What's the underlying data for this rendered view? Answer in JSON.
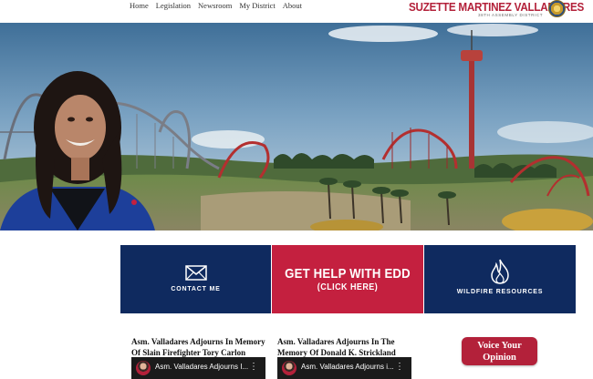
{
  "nav": {
    "items": [
      {
        "label": "Home"
      },
      {
        "label": "Legislation"
      },
      {
        "label": "Newsroom"
      },
      {
        "label": "My District"
      },
      {
        "label": "About"
      }
    ]
  },
  "brand": {
    "name": "SUZETTE MARTINEZ VALLADARES",
    "subtitle": "38TH ASSEMBLY DISTRICT"
  },
  "cta": {
    "contact_label": "CONTACT ME",
    "edd_title": "GET HELP WITH EDD",
    "edd_sub": "(CLICK HERE)",
    "wildfire_label": "WILDFIRE RESOURCES"
  },
  "news": [
    {
      "title_line1": "Asm. Valladares Adjourns In Memory",
      "title_line2": "Of Slain Firefighter Tory Carlon",
      "video_title": "Asm. Valladares Adjourns I..."
    },
    {
      "title_line1": "Asm. Valladares Adjourns In The",
      "title_line2": "Memory Of Donald K. Strickland",
      "video_title": "Asm. Valladares Adjourns i..."
    }
  ],
  "opinion": {
    "line1": "Voice Your",
    "line2": "Opinion"
  },
  "colors": {
    "navy": "#0f2a5f",
    "red": "#c4203f",
    "brand_red": "#b3213a"
  }
}
